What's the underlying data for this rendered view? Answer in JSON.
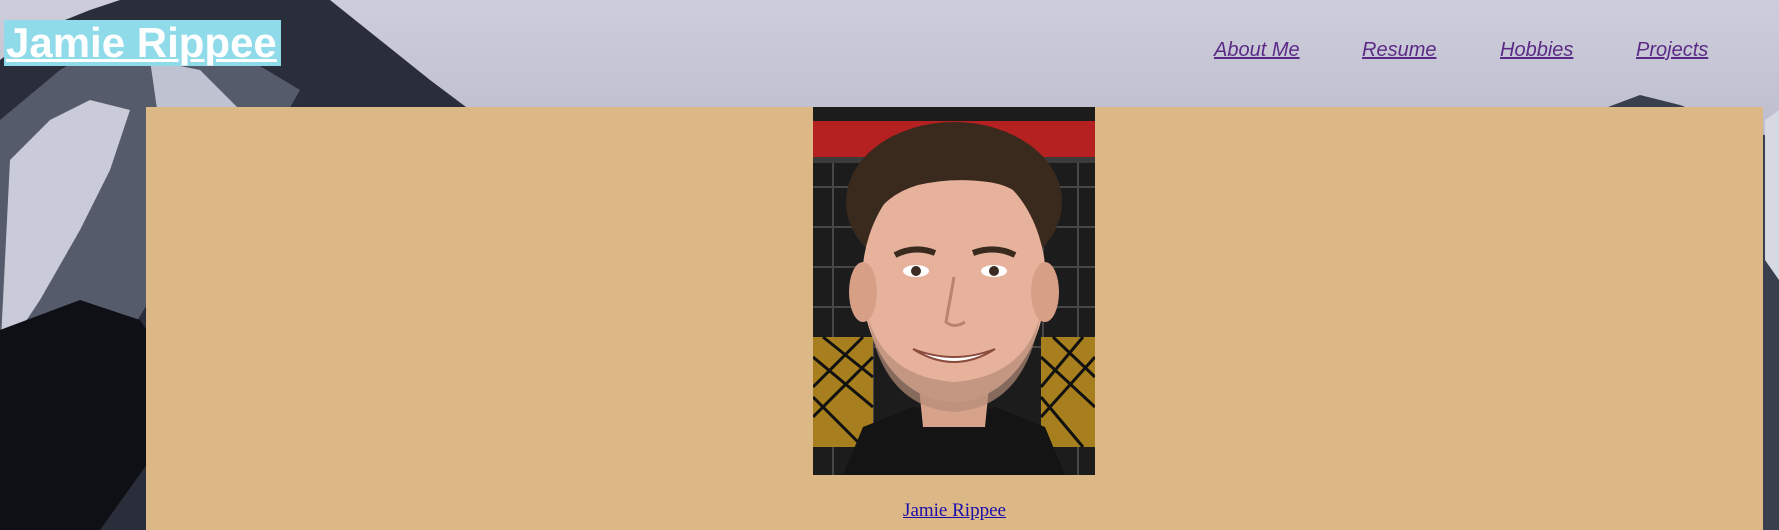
{
  "header": {
    "site_title": "Jamie Rippee"
  },
  "nav": {
    "items": [
      {
        "label": "About Me"
      },
      {
        "label": "Resume"
      },
      {
        "label": "Hobbies"
      },
      {
        "label": "Projects"
      }
    ]
  },
  "main": {
    "caption": "Jamie Rippee"
  },
  "colors": {
    "title_bg": "#8fdbea",
    "content_bg": "#ddb887",
    "nav_link": "#5b2a86",
    "caption_link": "#1a0dab"
  }
}
